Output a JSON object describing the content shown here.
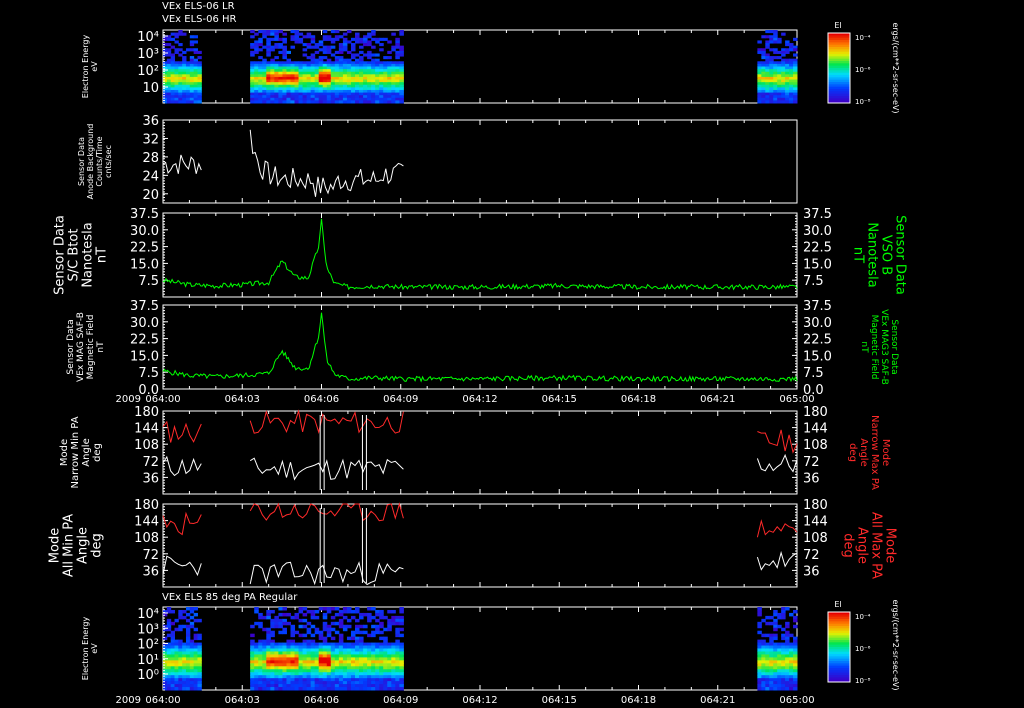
{
  "header": {
    "line1": "VEx ELS-06 LR",
    "line2": "VEx ELS-06 HR"
  },
  "colors": {
    "white": "#ffffff",
    "green": "#00ff00",
    "red": "#ff2a2a",
    "background": "#000000"
  },
  "colorbar": {
    "title": "El",
    "unit": "ergs/(cm**2-sr-sec-eV)",
    "ticks": [
      "10⁻⁴",
      "10⁻⁶",
      "10⁻⁸"
    ]
  },
  "x_axis": {
    "year": "2009",
    "ticks": [
      "064:00",
      "064:03",
      "064:06",
      "064:09",
      "064:12",
      "064:15",
      "064:18",
      "064:21",
      "065:00"
    ]
  },
  "bottom_title": "VEx ELS 85 deg PA Regular",
  "chart_data": [
    {
      "type": "heatmap",
      "id": "spec1",
      "ylabel": [
        "Electron Energy",
        "eV"
      ],
      "yscale": "log",
      "yticks": [
        "10⁴",
        "10³",
        "10²",
        "10"
      ],
      "coverage_min": [
        [
          0,
          1.45
        ],
        [
          3.3,
          9.1
        ],
        [
          22.5,
          24
        ]
      ],
      "features": "enhanced flux near 10-100 eV; peaks at 064:04.5 and 064:06"
    },
    {
      "type": "line",
      "id": "bg",
      "ylabel": [
        "Sensor Data",
        "Anode Background",
        "Counts/Time",
        "cnts/sec"
      ],
      "ylim": [
        18,
        36
      ],
      "yticks": [
        "36",
        "32",
        "28",
        "24",
        "20"
      ],
      "series": [
        {
          "x_min": [
            0,
            1.45
          ],
          "approx_mean": 26.5,
          "noise": 1.6
        },
        {
          "x_min": [
            3.3,
            9.1
          ],
          "approx_mean": 23,
          "noise": 1.6,
          "start_value": 33
        }
      ]
    },
    {
      "type": "line",
      "id": "bmag1",
      "ylabel": [
        "Sensor Data",
        "S/C Btot",
        "Nanotesla",
        "nT"
      ],
      "ylabel_right": [
        "Sensor Data",
        "VSO B",
        "Nanotesla",
        "nT"
      ],
      "ylim": [
        0,
        37.5
      ],
      "yticks": [
        "37.5",
        "30.0",
        "22.5",
        "15.0",
        "7.5"
      ],
      "series": [
        {
          "name": "B",
          "color": "green",
          "x_min": [
            0,
            1,
            2,
            3,
            4,
            4.5,
            5,
            5.5,
            5.9,
            6.0,
            6.2,
            6.5,
            7,
            8,
            9,
            12,
            15,
            18,
            21,
            24
          ],
          "values": [
            7.5,
            5.5,
            5,
            5.5,
            6.5,
            16,
            9,
            8.5,
            23,
            34,
            13,
            6,
            4.5,
            5,
            4.5,
            4.5,
            5,
            4.5,
            4.5,
            4.5
          ]
        }
      ]
    },
    {
      "type": "line",
      "id": "bmag2",
      "ylabel": [
        "Sensor Data",
        "VEx MAG SAF-B",
        "Magnetic Field",
        "nT"
      ],
      "ylabel_right": [
        "Sensor Data",
        "VEx MAG3 SAF-B",
        "Magnetic Field",
        "nT"
      ],
      "ylim": [
        0,
        37.5
      ],
      "yticks": [
        "37.5",
        "30.0",
        "22.5",
        "15.0",
        "7.5",
        "0.0"
      ],
      "series": [
        {
          "name": "B",
          "color": "green",
          "x_min": [
            0,
            1,
            2,
            3,
            4,
            4.5,
            5,
            5.5,
            5.9,
            6.0,
            6.2,
            6.5,
            7,
            8,
            9,
            12,
            15,
            18,
            21,
            24
          ],
          "values": [
            8,
            6,
            5.5,
            6,
            7,
            17,
            9.5,
            9,
            24,
            34,
            13,
            6.5,
            4.5,
            5,
            4.5,
            4.5,
            5,
            4.5,
            4.5,
            4.5
          ]
        }
      ]
    },
    {
      "type": "line",
      "id": "pa1",
      "ylabel": [
        "Mode",
        "Narrow Min PA",
        "Angle",
        "deg"
      ],
      "ylabel_right": [
        "Mode",
        "Narrow Max PA",
        "Angle",
        "deg"
      ],
      "ylim": [
        0,
        180
      ],
      "yticks": [
        "180",
        "144",
        "108",
        "72",
        "36"
      ],
      "series": [
        {
          "name": "Min PA",
          "color": "white",
          "segments": [
            [
              0,
              1.45,
              60
            ],
            [
              3.3,
              9.1,
              55
            ],
            [
              22.5,
              24,
              65
            ]
          ]
        },
        {
          "name": "Max PA",
          "color": "red",
          "segments": [
            [
              0,
              1.45,
              135
            ],
            [
              3.3,
              9.1,
              155
            ],
            [
              22.5,
              24,
              115
            ]
          ]
        }
      ]
    },
    {
      "type": "line",
      "id": "pa2",
      "ylabel": [
        "Mode",
        "All Min PA",
        "Angle",
        "deg"
      ],
      "ylabel_right": [
        "Mode",
        "All Max PA",
        "Angle",
        "deg"
      ],
      "ylim": [
        0,
        180
      ],
      "yticks": [
        "180",
        "144",
        "108",
        "72",
        "36"
      ],
      "series": [
        {
          "name": "Min PA",
          "color": "white",
          "segments": [
            [
              0,
              1.45,
              45
            ],
            [
              3.3,
              9.1,
              30
            ],
            [
              22.5,
              24,
              55
            ]
          ]
        },
        {
          "name": "Max PA",
          "color": "red",
          "segments": [
            [
              0,
              1.45,
              135
            ],
            [
              3.3,
              9.1,
              165
            ],
            [
              22.5,
              24,
              125
            ]
          ]
        }
      ]
    },
    {
      "type": "heatmap",
      "id": "spec2",
      "ylabel": [
        "Electron Energy",
        "eV"
      ],
      "yscale": "log",
      "yticks": [
        "10⁴",
        "10³",
        "10²",
        "10¹",
        "10⁰"
      ],
      "coverage_min": [
        [
          0,
          1.45
        ],
        [
          3.3,
          9.1
        ],
        [
          22.5,
          24
        ]
      ],
      "features": "enhanced flux near 10-100 eV; peaks at 064:04.5 and 064:06"
    }
  ]
}
